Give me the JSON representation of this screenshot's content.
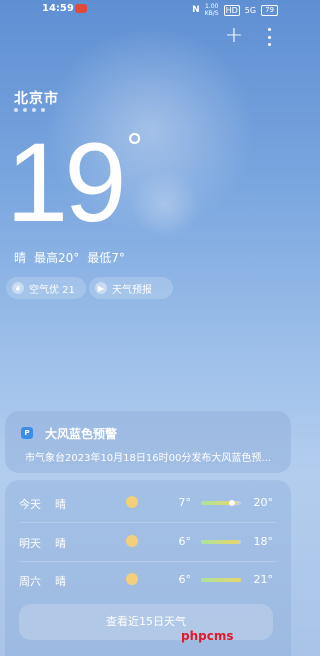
{
  "status_bar": {
    "time": "14:59",
    "app_badge": "",
    "net_speed_value": "1.00",
    "net_speed_unit": "KB/S",
    "network_label": "HD",
    "signal": "5G",
    "battery": "79"
  },
  "location": {
    "city": "北京市"
  },
  "current": {
    "temperature": "19",
    "degree_symbol": "°",
    "condition": "晴",
    "high": "最高20°",
    "low": "最低7°"
  },
  "chips": {
    "aqi": "空气优 21",
    "forecast": "天气预报"
  },
  "warning": {
    "icon": "warning-flag-icon",
    "title": "大风蓝色预警",
    "text": "市气象台2023年10月18日16时00分发布大风蓝色预..."
  },
  "forecast": {
    "rows": [
      {
        "day": "今天",
        "condition": "晴",
        "icon": "sun-icon",
        "low": "7°",
        "high": "20°",
        "range_start": 0.0,
        "range_end": 0.9,
        "current_position": 0.78
      },
      {
        "day": "明天",
        "condition": "晴",
        "icon": "sun-icon",
        "low": "6°",
        "high": "18°",
        "range_start": 0.0,
        "range_end": 0.95
      },
      {
        "day": "周六",
        "condition": "晴",
        "icon": "sun-icon",
        "low": "6°",
        "high": "21°",
        "range_start": 0.0,
        "range_end": 1.0
      }
    ],
    "more_button": "查看近15日天气"
  },
  "watermark": "phpcms"
}
